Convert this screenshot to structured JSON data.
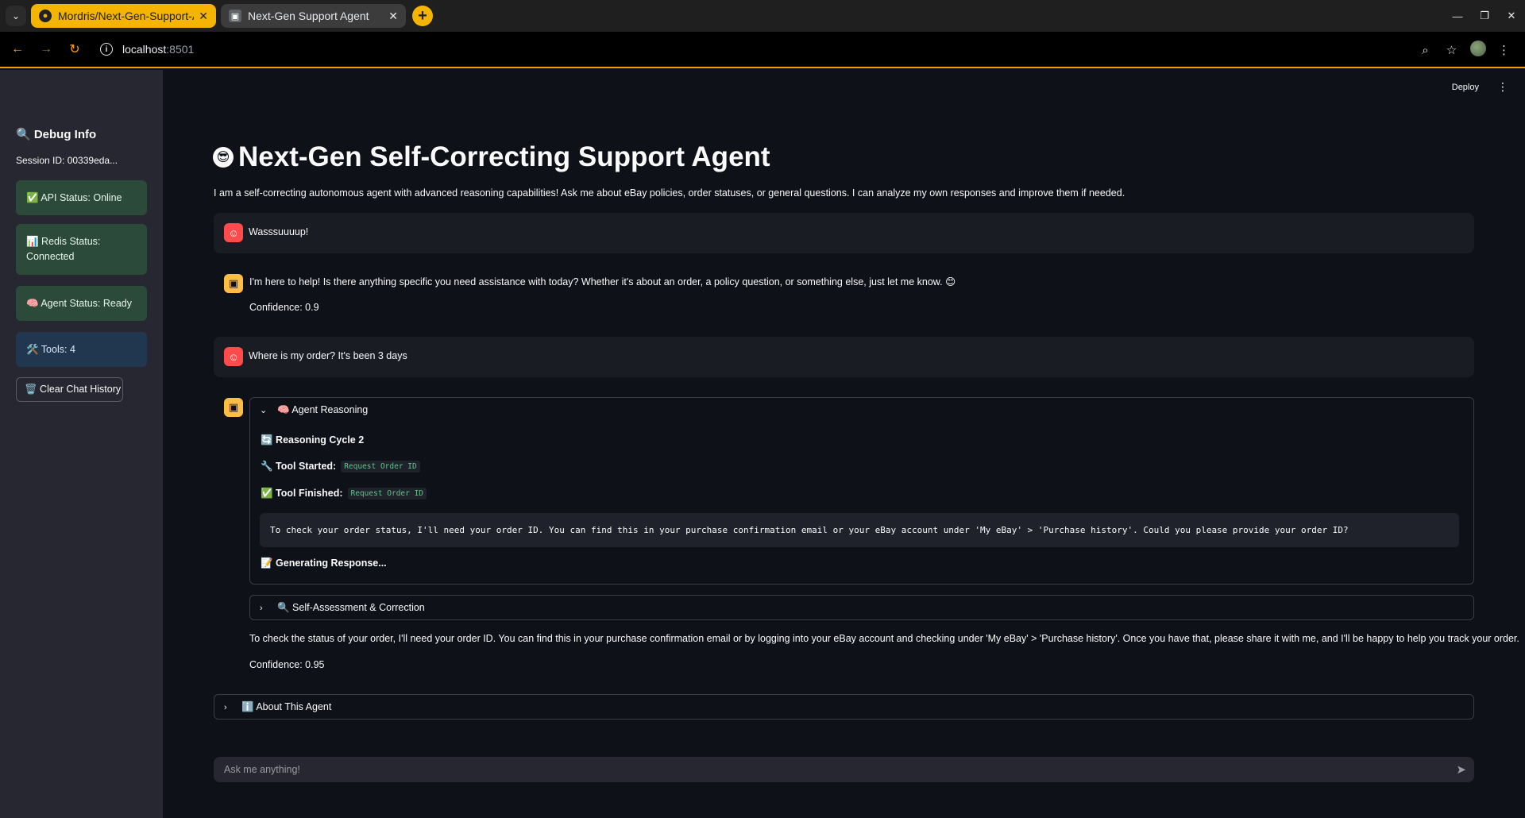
{
  "browser": {
    "tabs": [
      {
        "title": "Mordris/Next-Gen-Support-A",
        "favicon": "github-icon"
      },
      {
        "title": "Next-Gen Support Agent",
        "favicon": "robot-icon"
      }
    ],
    "url_host": "localhost",
    "url_port": ":8501"
  },
  "sidebar": {
    "title": "🔍 Debug Info",
    "session": "Session ID: 00339eda...",
    "api_status": "✅ API Status: Online",
    "redis_status_line1": "📊 Redis Status:",
    "redis_status_line2": "Connected",
    "agent_status": "🧠 Agent Status: Ready",
    "tools": "🛠️ Tools: 4",
    "clear_button": "🗑️ Clear Chat History"
  },
  "header": {
    "deploy": "Deploy"
  },
  "main": {
    "title": "Next-Gen Self-Correcting Support Agent",
    "title_icon": "😎",
    "intro": "I am a self-correcting autonomous agent with advanced reasoning capabilities! Ask me about eBay policies, order statuses, or general questions. I can analyze my own responses and improve them if needed.",
    "messages": {
      "user1": "Wasssuuuup!",
      "bot1": "I'm here to help! Is there anything specific you need assistance with today? Whether it's about an order, a policy question, or something else, just let me know. 😊",
      "bot1_confidence": "Confidence: 0.9",
      "user2": "Where is my order? It's been 3 days",
      "reasoning": {
        "label": "🧠 Agent Reasoning",
        "cycle": "🔄 Reasoning Cycle 2",
        "tool_started_label": "🔧 Tool Started:",
        "tool_started_value": "Request Order ID",
        "tool_finished_label": "✅ Tool Finished:",
        "tool_finished_value": "Request Order ID",
        "code": "To check your order status, I'll need your order ID. You can find this in your purchase confirmation email or your eBay account under 'My eBay' > 'Purchase history'. Could you please provide your order ID?",
        "generating": "📝 Generating Response..."
      },
      "self_assessment": "🔍 Self-Assessment & Correction",
      "bot2": "To check the status of your order, I'll need your order ID. You can find this in your purchase confirmation email or by logging into your eBay account and checking under 'My eBay' > 'Purchase history'. Once you have that, please share it with me, and I'll be happy to help you track your order.",
      "bot2_confidence": "Confidence: 0.95"
    },
    "about": "ℹ️ About This Agent",
    "input_placeholder": "Ask me anything!"
  }
}
